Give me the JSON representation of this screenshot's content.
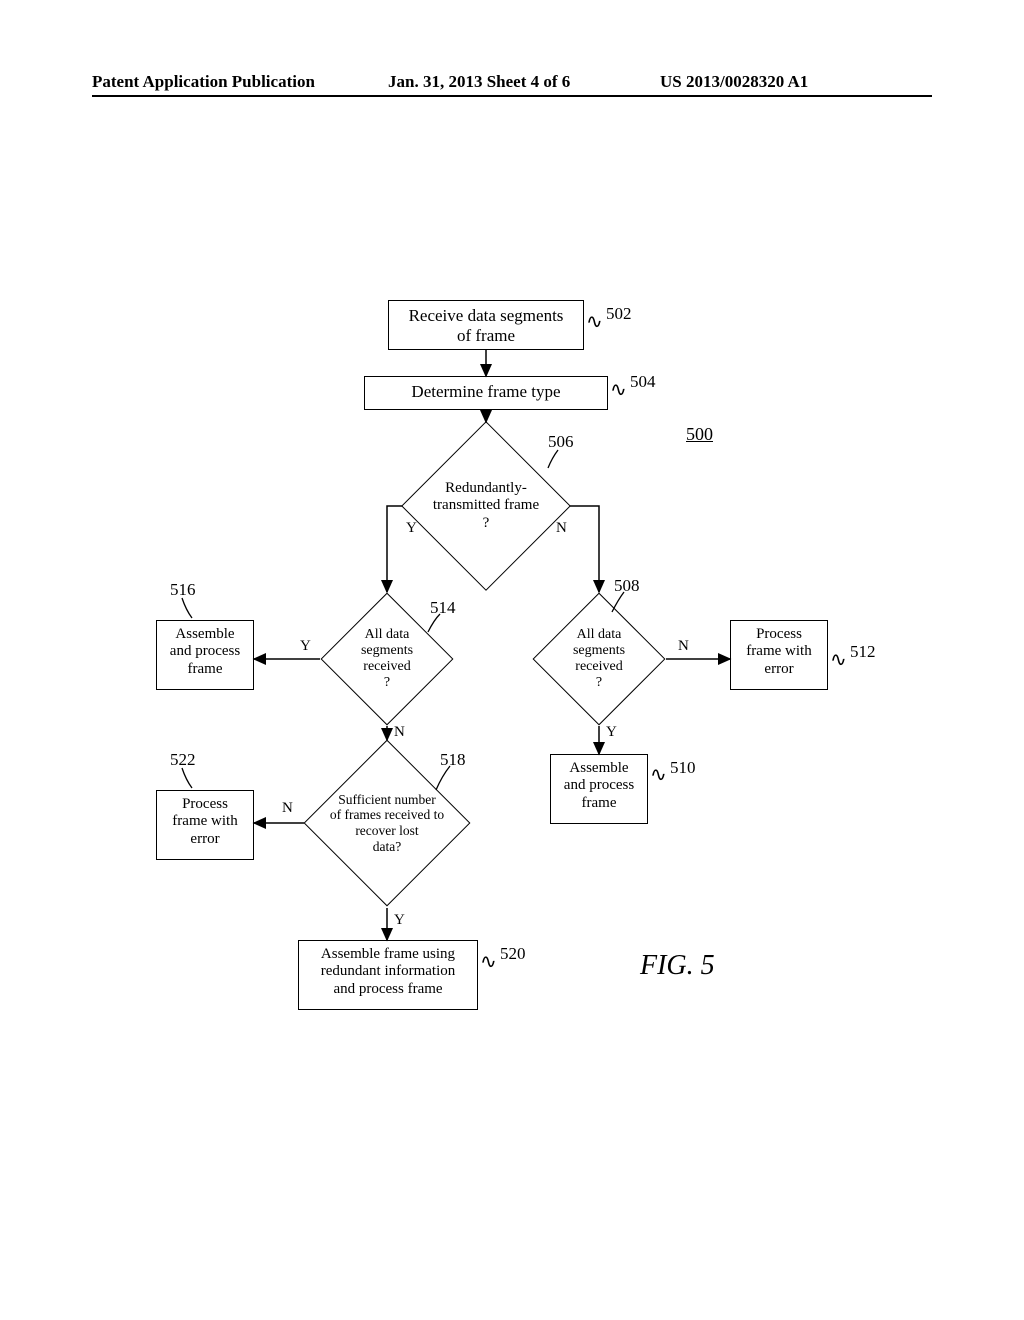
{
  "header": {
    "left": "Patent Application Publication",
    "center": "Jan. 31, 2013  Sheet 4 of 6",
    "right": "US 2013/0028320 A1"
  },
  "diagram_ref": "500",
  "figure_label": "FIG. 5",
  "refs": {
    "r502": "502",
    "r504": "504",
    "r506": "506",
    "r508": "508",
    "r510": "510",
    "r512": "512",
    "r514": "514",
    "r516": "516",
    "r518": "518",
    "r520": "520",
    "r522": "522"
  },
  "labels": {
    "Y": "Y",
    "N": "N"
  },
  "steps": {
    "s502": "Receive data segments\nof frame",
    "s504": "Determine frame type",
    "s506": "Redundantly-\ntransmitted frame\n?",
    "s508": "All data\nsegments\nreceived\n?",
    "s510": "Assemble\nand process\nframe",
    "s512": "Process\nframe with\nerror",
    "s514": "All data\nsegments\nreceived\n?",
    "s516": "Assemble\nand process\nframe",
    "s518": "Sufficient number\nof frames received to\nrecover lost\ndata?",
    "s520": "Assemble frame using\nredundant information\nand process frame",
    "s522": "Process\nframe with\nerror"
  },
  "chart_data": {
    "type": "flowchart",
    "title": "FIG. 5",
    "diagram_ref": "500",
    "nodes": [
      {
        "id": "502",
        "type": "process",
        "text": "Receive data segments of frame"
      },
      {
        "id": "504",
        "type": "process",
        "text": "Determine frame type"
      },
      {
        "id": "506",
        "type": "decision",
        "text": "Redundantly-transmitted frame ?"
      },
      {
        "id": "508",
        "type": "decision",
        "text": "All data segments received ?"
      },
      {
        "id": "510",
        "type": "process",
        "text": "Assemble and process frame"
      },
      {
        "id": "512",
        "type": "process",
        "text": "Process frame with error"
      },
      {
        "id": "514",
        "type": "decision",
        "text": "All data segments received ?"
      },
      {
        "id": "516",
        "type": "process",
        "text": "Assemble and process frame"
      },
      {
        "id": "518",
        "type": "decision",
        "text": "Sufficient number of frames received to recover lost data?"
      },
      {
        "id": "520",
        "type": "process",
        "text": "Assemble frame using redundant information and process frame"
      },
      {
        "id": "522",
        "type": "process",
        "text": "Process frame with error"
      }
    ],
    "edges": [
      {
        "from": "502",
        "to": "504"
      },
      {
        "from": "504",
        "to": "506"
      },
      {
        "from": "506",
        "to": "514",
        "label": "Y"
      },
      {
        "from": "506",
        "to": "508",
        "label": "N"
      },
      {
        "from": "508",
        "to": "512",
        "label": "N"
      },
      {
        "from": "508",
        "to": "510",
        "label": "Y"
      },
      {
        "from": "514",
        "to": "516",
        "label": "Y"
      },
      {
        "from": "514",
        "to": "518",
        "label": "N"
      },
      {
        "from": "518",
        "to": "520",
        "label": "Y"
      },
      {
        "from": "518",
        "to": "522",
        "label": "N"
      }
    ]
  }
}
